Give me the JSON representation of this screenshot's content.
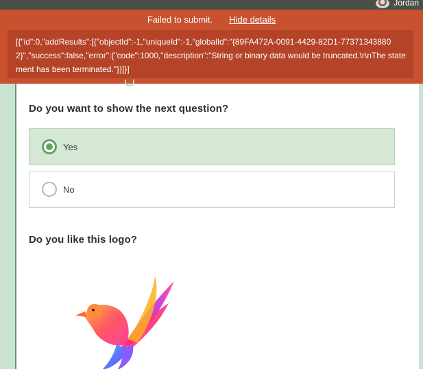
{
  "header": {
    "user_name": "Jordan"
  },
  "error": {
    "title": "Failed to submit.",
    "toggle_label": "Hide details",
    "details": "[{\"id\":0,\"addResults\":[{\"objectId\":-1,\"uniqueId\":-1,\"globalId\":\"{89FA472A-0091-4429-82D1-773713438802}\",\"success\":false,\"error\":{\"code\":1000,\"description\":\"String or binary data would be truncated.\\r\\nThe statement has been terminated.\"}}]}]",
    "colors": {
      "banner": "#c8512f",
      "detail_box": "#b54328"
    }
  },
  "form": {
    "question1": {
      "title": "Do you want to show the next question?",
      "options": [
        {
          "label": "Yes",
          "selected": true
        },
        {
          "label": "No",
          "selected": false
        }
      ]
    },
    "question2": {
      "title": "Do you like this logo?",
      "image_icon": "bird-logo-icon"
    },
    "colors": {
      "accent": "#5fa463",
      "selected_bg": "#d5e8d5",
      "page_bg": "#c9e2d1"
    }
  }
}
